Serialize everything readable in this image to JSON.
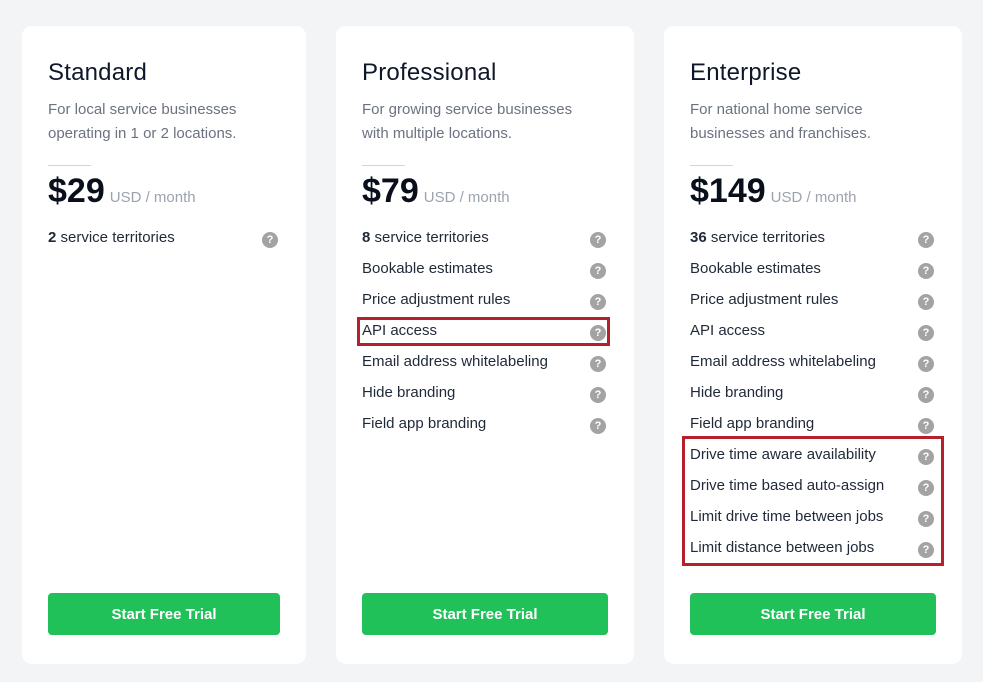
{
  "plans": [
    {
      "name": "Standard",
      "description": "For local service businesses operating in 1 or 2 locations.",
      "price": "$29",
      "price_unit": "USD / month",
      "territories": {
        "count": "2",
        "label": " service territories"
      },
      "features": [],
      "cta": "Start Free Trial"
    },
    {
      "name": "Professional",
      "description": "For growing service businesses with multiple locations.",
      "price": "$79",
      "price_unit": "USD / month",
      "territories": {
        "count": "8",
        "label": " service territories"
      },
      "features": [
        "Bookable estimates",
        "Price adjustment rules",
        "API access",
        "Email address whitelabeling",
        "Hide branding",
        "Field app branding"
      ],
      "cta": "Start Free Trial"
    },
    {
      "name": "Enterprise",
      "description": "For national home service businesses and franchises.",
      "price": "$149",
      "price_unit": "USD / month",
      "territories": {
        "count": "36",
        "label": " service territories"
      },
      "features": [
        "Bookable estimates",
        "Price adjustment rules",
        "API access",
        "Email address whitelabeling",
        "Hide branding",
        "Field app branding",
        "Drive time aware availability",
        "Drive time based auto-assign",
        "Limit drive time between jobs",
        "Limit distance between jobs"
      ],
      "cta": "Start Free Trial"
    }
  ],
  "help_glyph": "?",
  "colors": {
    "cta": "#21c15a",
    "highlight": "#b5202a",
    "help_icon": "#a3a3a3"
  }
}
